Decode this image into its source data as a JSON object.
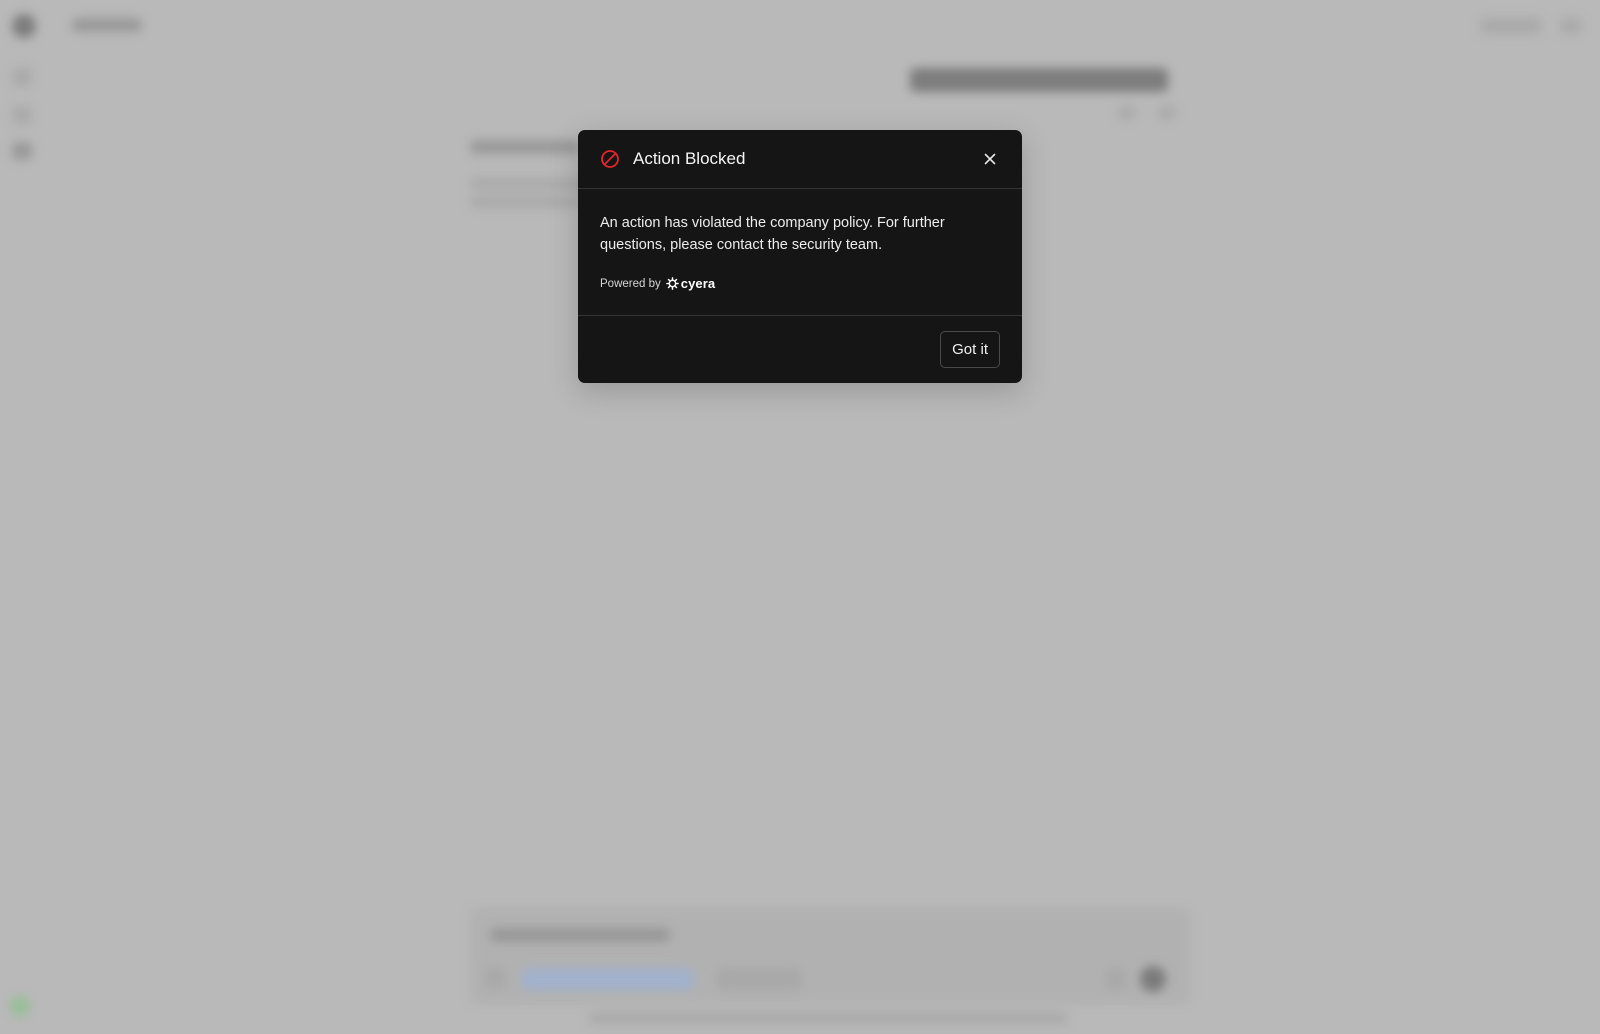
{
  "dialog": {
    "title": "Action Blocked",
    "message": "An action has violated the company policy. For further questions, please contact the security team.",
    "powered_by_label": "Powered by",
    "brand_name": "cyera",
    "confirm_label": "Got it",
    "block_icon": "block-icon",
    "close_icon": "close-icon"
  },
  "colors": {
    "backdrop": "#b9b9b9",
    "dialog_background": "#151515",
    "block_icon": "#e5242a"
  }
}
